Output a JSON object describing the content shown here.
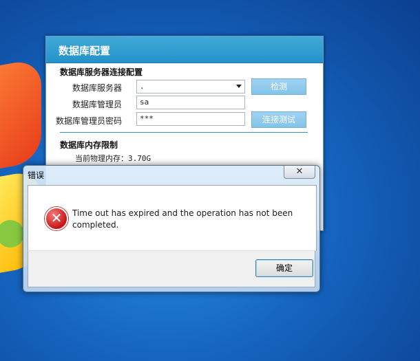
{
  "config_window": {
    "title": "数据库配置",
    "section_connection": "数据库服务器连接配置",
    "server_label": "数据库服务器",
    "server_value": ".",
    "admin_label": "数据库管理员",
    "admin_value": "sa",
    "password_label": "数据库管理员密码",
    "password_value": "***",
    "detect_button": "检测",
    "test_button": "连接测试",
    "section_memory": "数据库内存限制",
    "memory_label": "当前物理内存：",
    "memory_value": "3.70G"
  },
  "error_dialog": {
    "title": "错误",
    "close_glyph": "✕",
    "icon": "error-icon",
    "message": "Time out has expired and the operation has not been completed.",
    "ok_button": "确定"
  },
  "colors": {
    "titlebar_blue": "#2492c9",
    "button_blue": "#85c3ea",
    "error_red": "#c81414"
  }
}
